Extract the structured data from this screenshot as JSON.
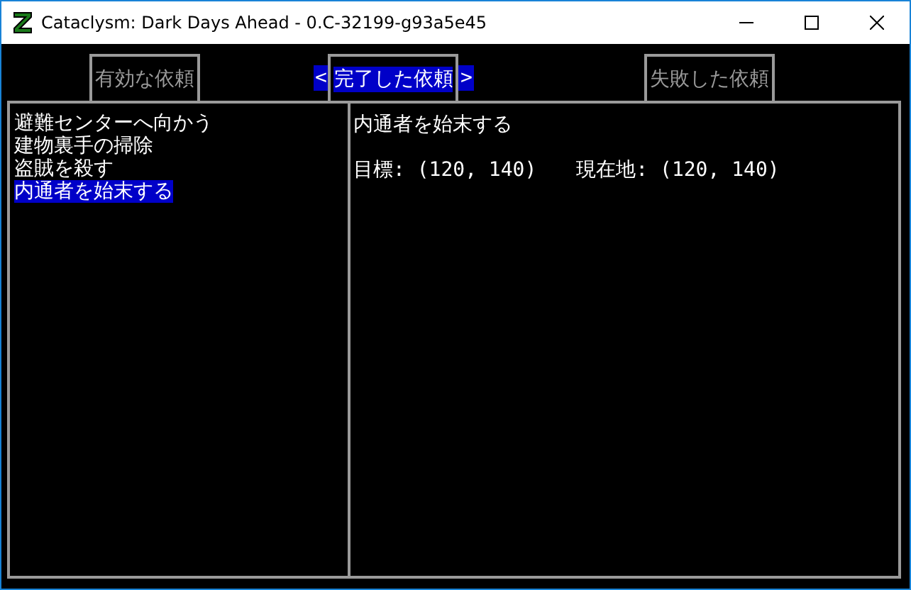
{
  "window": {
    "title": "Cataclysm: Dark Days Ahead - 0.C-32199-g93a5e45"
  },
  "tab_arrows": {
    "left": "<",
    "right": ">"
  },
  "tabs": [
    {
      "label": "有効な依頼",
      "selected": false
    },
    {
      "label": "完了した依頼",
      "selected": true
    },
    {
      "label": "失敗した依頼",
      "selected": false
    }
  ],
  "quests": [
    {
      "name": "避難センターへ向かう",
      "selected": false
    },
    {
      "name": "建物裏手の掃除",
      "selected": false
    },
    {
      "name": "盗賊を殺す",
      "selected": false
    },
    {
      "name": "内通者を始末する",
      "selected": true
    }
  ],
  "detail": {
    "title": "内通者を始末する",
    "target": "目標: (120, 140)",
    "current": "現在地: (120, 140)"
  }
}
